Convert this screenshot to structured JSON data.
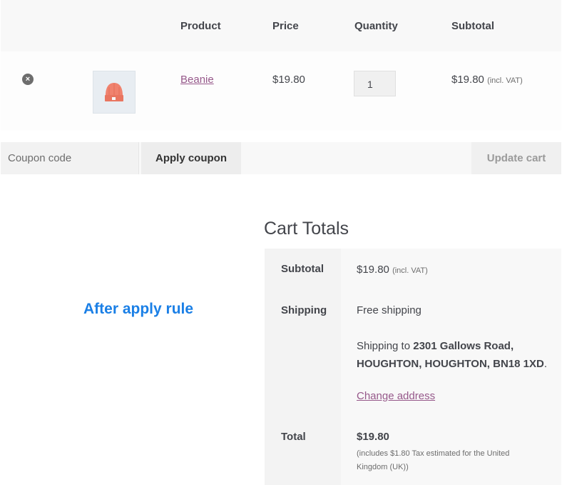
{
  "cart_table": {
    "headers": {
      "product": "Product",
      "price": "Price",
      "quantity": "Quantity",
      "subtotal": "Subtotal"
    },
    "items": [
      {
        "remove_glyph": "×",
        "thumbnail_icon": "beanie-hat-icon",
        "name": "Beanie",
        "price": "$19.80",
        "quantity": "1",
        "subtotal": "$19.80",
        "subtotal_note": "(incl. VAT)"
      }
    ]
  },
  "actions": {
    "coupon_placeholder": "Coupon code",
    "apply_label": "Apply coupon",
    "update_label": "Update cart"
  },
  "annotation": "After apply rule",
  "cart_totals": {
    "title": "Cart Totals",
    "subtotal_label": "Subtotal",
    "subtotal_value": "$19.80",
    "subtotal_note": "(incl. VAT)",
    "shipping_label": "Shipping",
    "shipping_method": "Free shipping",
    "shipping_to_prefix": "Shipping to",
    "address_line1": "2301 Gallows Road,",
    "address_line2": "HOUGHTON, HOUGHTON, BN18 1XD",
    "change_address": "Change address",
    "total_label": "Total",
    "total_value": "$19.80",
    "tax_note_line1": "(includes $1.80 Tax estimated for the United",
    "tax_note_line2": "Kingdom (UK))"
  },
  "colors": {
    "link": "#96588a",
    "annotation": "#1a7fe6",
    "beanie": "#f0826e"
  }
}
